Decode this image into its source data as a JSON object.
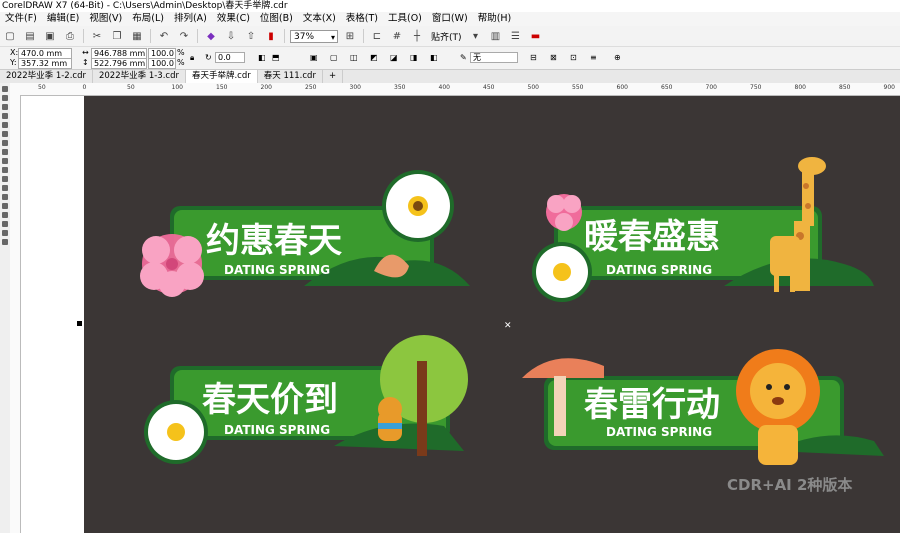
{
  "app": {
    "title": "CorelDRAW X7 (64-Bit) - C:\\Users\\Admin\\Desktop\\春天手举牌.cdr"
  },
  "menu": [
    "文件(F)",
    "编辑(E)",
    "视图(V)",
    "布局(L)",
    "排列(A)",
    "效果(C)",
    "位图(B)",
    "文本(X)",
    "表格(T)",
    "工具(O)",
    "窗口(W)",
    "帮助(H)"
  ],
  "toolbar": {
    "zoom": "37%",
    "snap_label": "贴齐(T)"
  },
  "property_bar": {
    "x_label": "X:",
    "x_value": "470.0 mm",
    "y_label": "Y:",
    "y_value": "357.32 mm",
    "w_value": "946.788 mm",
    "h_value": "522.796 mm",
    "sx_value": "100.0",
    "sy_value": "100.0",
    "pct": "%",
    "rotation": "0.0",
    "outline": "无"
  },
  "tabs": [
    "2022毕业季 1-2.cdr",
    "2022毕业季 1-3.cdr",
    "春天手举牌.cdr",
    "春天 111.cdr",
    "+"
  ],
  "active_tab": 2,
  "ruler": {
    "h_ticks": [
      "50",
      "0",
      "50",
      "100",
      "150",
      "200",
      "250",
      "300",
      "350",
      "400",
      "450",
      "500",
      "550",
      "600",
      "650",
      "700",
      "750",
      "800",
      "850",
      "900"
    ]
  },
  "signs": [
    {
      "title": "约惠春天",
      "subtitle": "DATING SPRING"
    },
    {
      "title": "暖春盛惠",
      "subtitle": "DATING SPRING"
    },
    {
      "title": "春天价到",
      "subtitle": "DATING SPRING"
    },
    {
      "title": "春雷行动",
      "subtitle": "DATING SPRING"
    }
  ],
  "watermark": "CDR+AI 2种版本",
  "colors": {
    "canvas": "#3b3635",
    "sign_green": "#3a9a2e",
    "sign_dark": "#1f6b2a"
  }
}
